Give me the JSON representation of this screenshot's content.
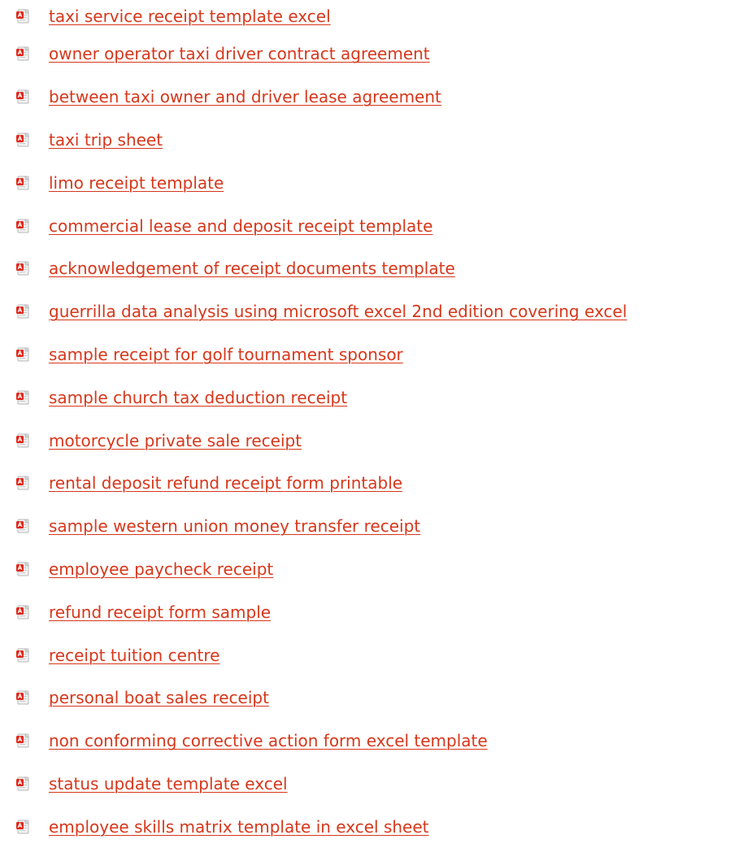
{
  "links": [
    {
      "label": "taxi service receipt template excel",
      "icon": "pdf-file-icon"
    },
    {
      "label": "owner operator taxi driver contract agreement",
      "icon": "pdf-file-icon"
    },
    {
      "label": "between taxi owner and driver lease agreement",
      "icon": "pdf-file-icon"
    },
    {
      "label": "taxi trip sheet",
      "icon": "pdf-file-icon"
    },
    {
      "label": "limo receipt template",
      "icon": "pdf-file-icon"
    },
    {
      "label": "commercial lease and deposit receipt template",
      "icon": "pdf-file-icon"
    },
    {
      "label": "acknowledgement of receipt documents template",
      "icon": "pdf-file-icon"
    },
    {
      "label": "guerrilla data analysis using microsoft excel 2nd edition covering excel",
      "icon": "pdf-file-icon"
    },
    {
      "label": "sample receipt for golf tournament sponsor",
      "icon": "pdf-file-icon"
    },
    {
      "label": "sample church tax deduction receipt",
      "icon": "pdf-file-icon"
    },
    {
      "label": "motorcycle private sale receipt",
      "icon": "pdf-file-icon"
    },
    {
      "label": "rental deposit refund receipt form printable",
      "icon": "pdf-file-icon"
    },
    {
      "label": "sample western union money transfer receipt",
      "icon": "pdf-file-icon"
    },
    {
      "label": "employee paycheck receipt",
      "icon": "pdf-file-icon"
    },
    {
      "label": "refund receipt form sample",
      "icon": "pdf-file-icon"
    },
    {
      "label": "receipt tuition centre",
      "icon": "pdf-file-icon"
    },
    {
      "label": "personal boat sales receipt",
      "icon": "pdf-file-icon"
    },
    {
      "label": "non conforming corrective action form excel template",
      "icon": "pdf-file-icon"
    },
    {
      "label": "status update template excel",
      "icon": "pdf-file-icon"
    },
    {
      "label": "employee skills matrix template in excel sheet",
      "icon": "pdf-file-icon"
    }
  ],
  "colors": {
    "link": "#d7371b",
    "icon_red": "#e1281a",
    "icon_paper": "#f2f2f2",
    "icon_border": "#b8b8b8"
  }
}
